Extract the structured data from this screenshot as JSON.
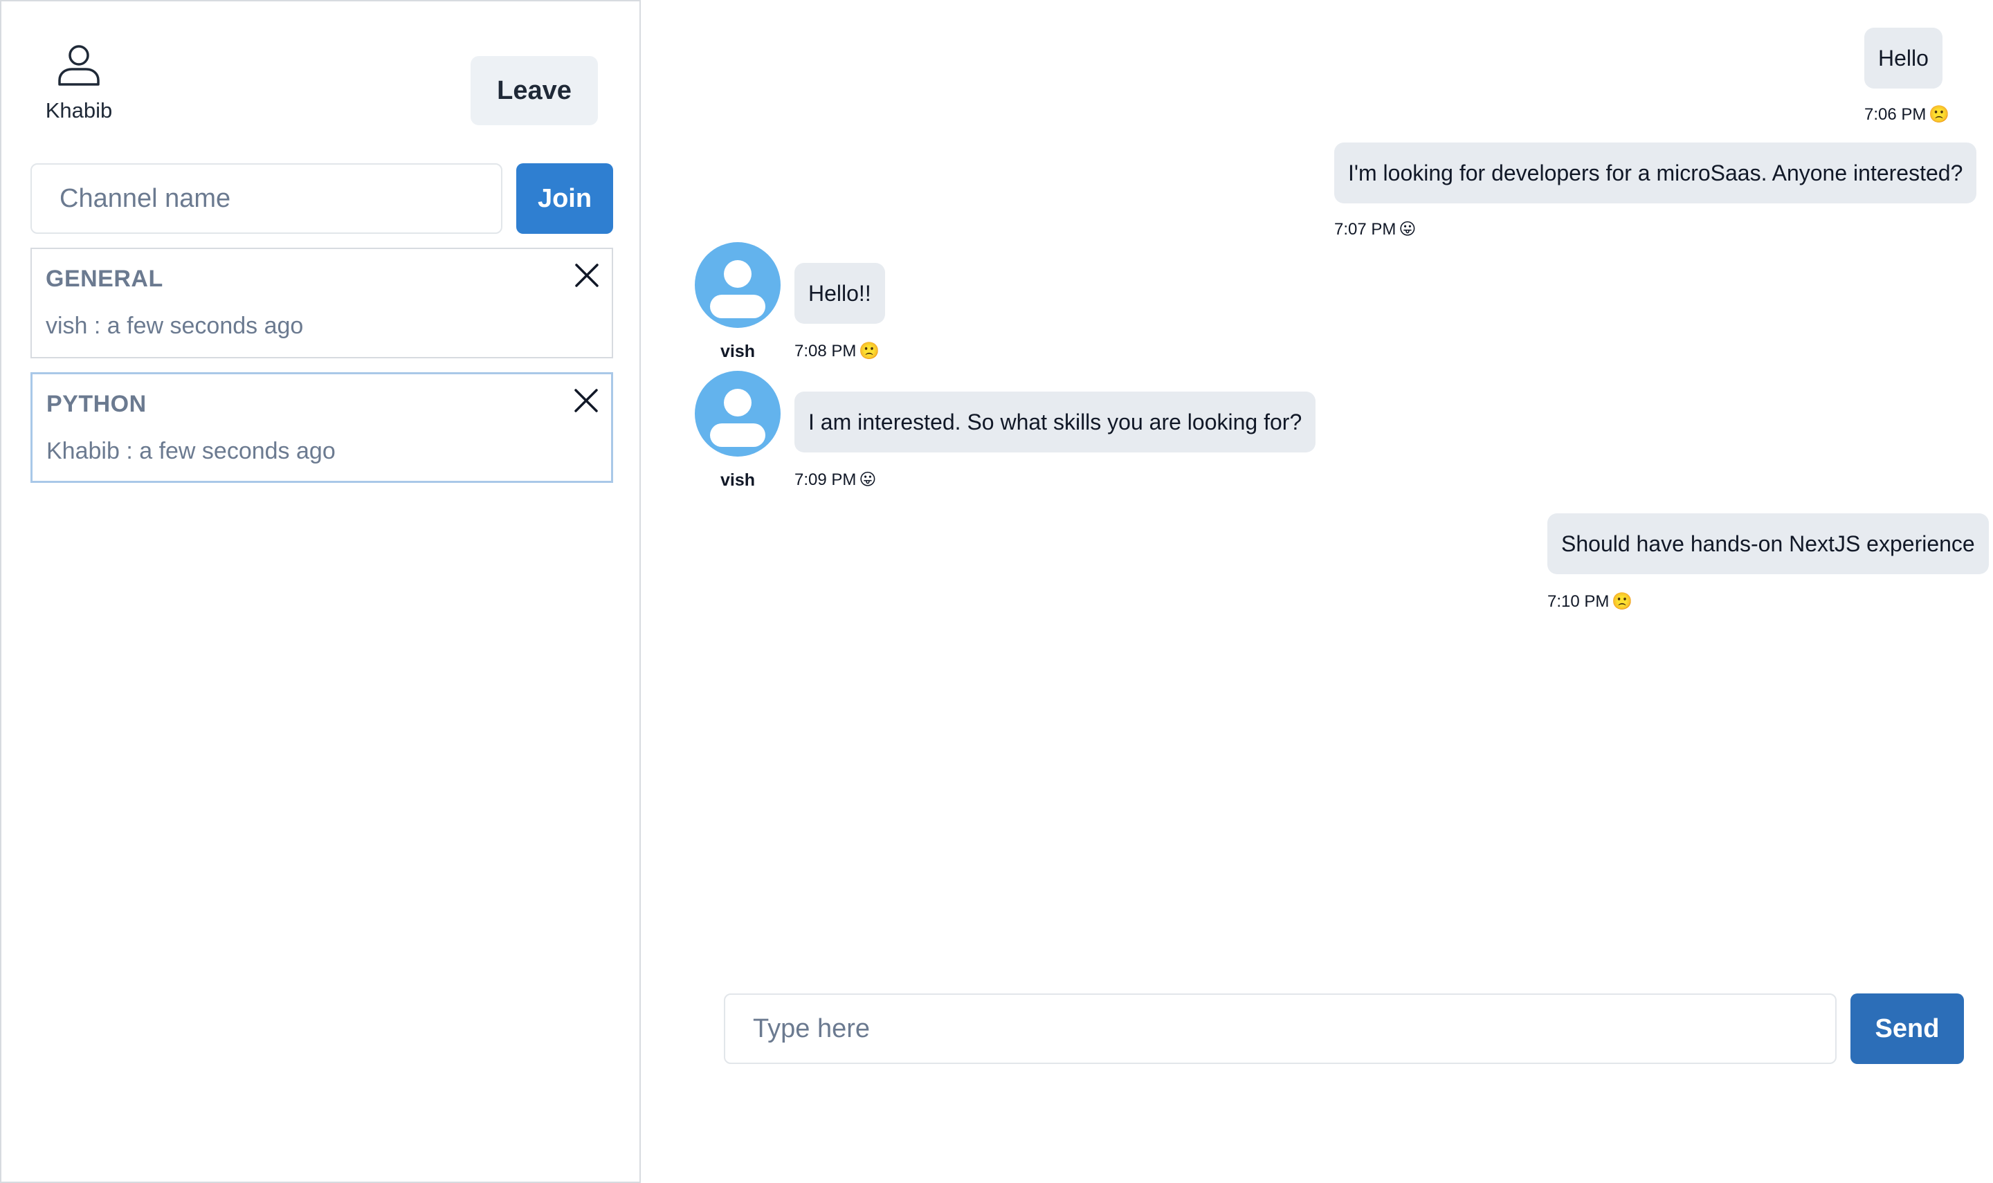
{
  "user": {
    "name": "Khabib",
    "icon": "user-icon"
  },
  "sidebar": {
    "leave_label": "Leave",
    "channel_placeholder": "Channel name",
    "join_label": "Join",
    "channels": [
      {
        "name": "GENERAL",
        "last_message": "vish : a few seconds ago",
        "active": false
      },
      {
        "name": "PYTHON",
        "last_message": "Khabib : a few seconds ago",
        "active": true
      }
    ]
  },
  "chat": {
    "messages": [
      {
        "text": "Hello",
        "time": "7:06 PM",
        "emoji": "🙁",
        "from_self": true
      },
      {
        "text": "I'm looking for developers for a microSaas. Anyone interested?",
        "time": "7:07 PM",
        "emoji": "😛",
        "from_self": true
      },
      {
        "sender": "vish",
        "text": "Hello!!",
        "time": "7:08 PM",
        "emoji": "🙁",
        "from_self": false
      },
      {
        "sender": "vish",
        "text": "I am interested. So what skills you are looking for?",
        "time": "7:09 PM",
        "emoji": "😛",
        "from_self": false
      },
      {
        "text": "Should have hands-on NextJS experience",
        "time": "7:10 PM",
        "emoji": "🙁",
        "from_self": true
      }
    ],
    "input_placeholder": "Type here",
    "send_label": "Send"
  },
  "colors": {
    "primary": "#2f7fd1",
    "send": "#2c6eb8",
    "bubble": "#e7ebf0",
    "avatar": "#63b3ed",
    "muted_text": "#6b7a90"
  }
}
